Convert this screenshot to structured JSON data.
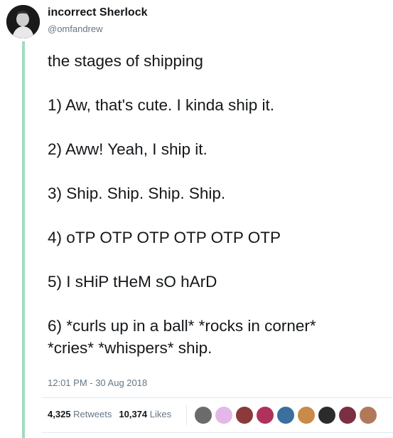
{
  "tweet": {
    "display_name": "incorrect Sherlock",
    "handle": "@omfandrew",
    "lines": [
      "the stages of shipping",
      "1) Aw, that's cute. I kinda ship it.",
      "2) Aww! Yeah, I ship it.",
      "3) Ship. Ship. Ship. Ship.",
      "4) oTP OTP OTP OTP OTP OTP",
      "5) I sHiP tHeM sO hArD",
      "6) *curls up in a ball* *rocks in corner*",
      "*cries* *whispers* ship."
    ],
    "timestamp": "12:01 PM - 30 Aug 2018"
  },
  "stats": {
    "retweets_count": "4,325",
    "retweets_label": "Retweets",
    "likes_count": "10,374",
    "likes_label": "Likes"
  },
  "colors": {
    "thread_line": "#9fdcbd",
    "text": "#14171a",
    "secondary_text": "#657786",
    "divider": "#e1e8ed"
  },
  "likers": [
    {
      "color": "#6b6b6b"
    },
    {
      "color": "#e3b8e8"
    },
    {
      "color": "#8a3a3a"
    },
    {
      "color": "#b0325a"
    },
    {
      "color": "#3a6f9e"
    },
    {
      "color": "#c98a4a"
    },
    {
      "color": "#2b2b2b"
    },
    {
      "color": "#7a3040"
    },
    {
      "color": "#b07a5a"
    }
  ]
}
